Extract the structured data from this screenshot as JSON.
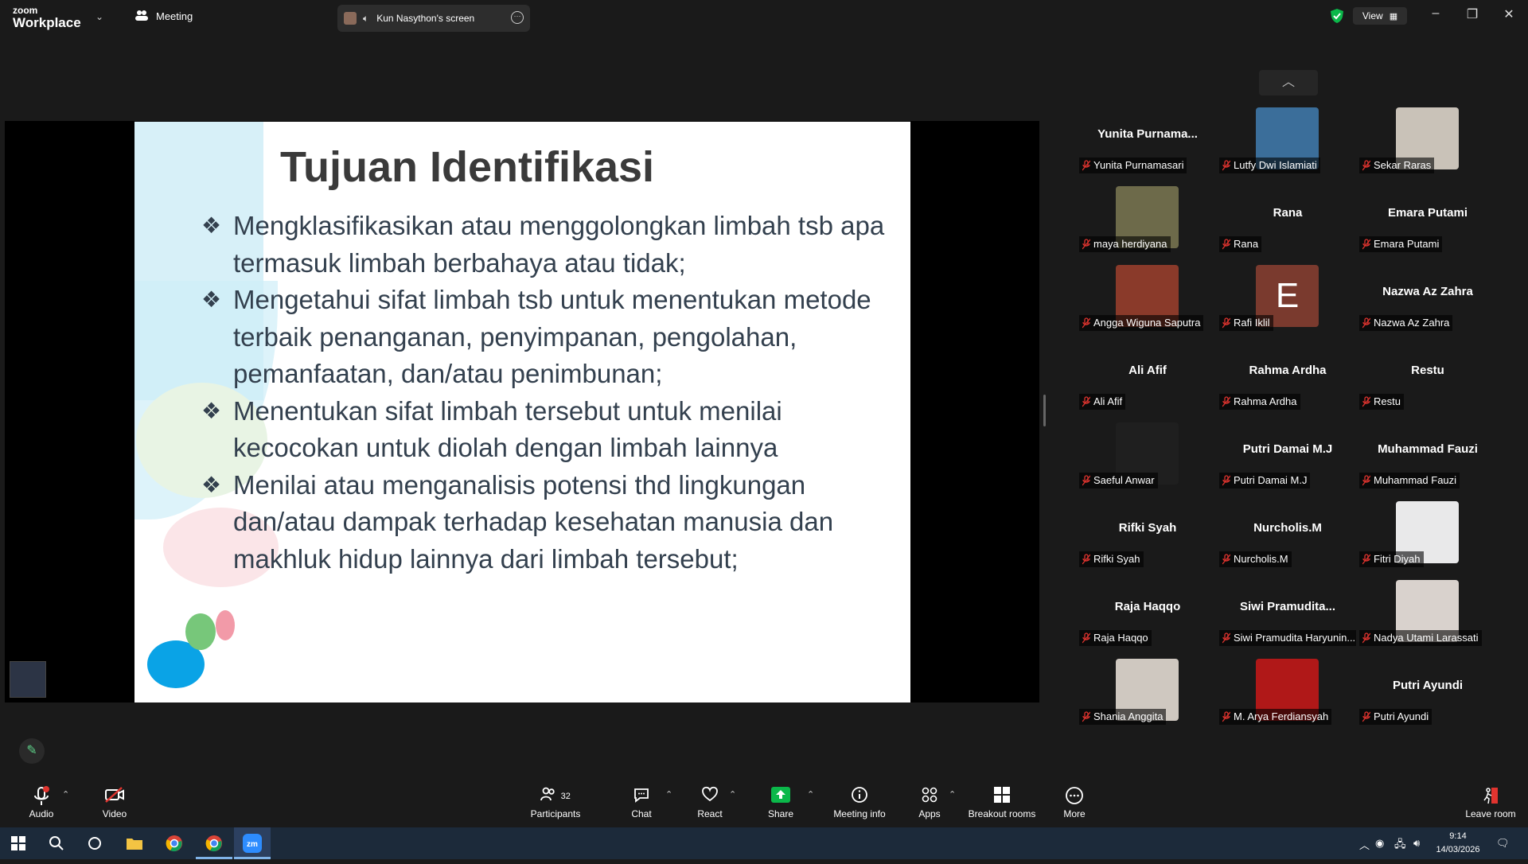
{
  "titlebar": {
    "logo_small": "zoom",
    "logo_big": "Workplace",
    "meeting_label": "Meeting",
    "screen_tab_label": "Kun Nasython's screen",
    "view_label": "View"
  },
  "slide": {
    "title": "Tujuan Identifikasi",
    "bullets": [
      "Mengklasifikasikan atau menggolongkan limbah tsb apa termasuk limbah berbahaya atau tidak;",
      "Mengetahui sifat limbah tsb untuk menentukan metode terbaik penanganan, penyimpanan, pengolahan, pemanfaatan, dan/atau penimbunan;",
      "Menentukan sifat limbah tersebut untuk menilai kecocokan untuk diolah dengan limbah lainnya",
      "Menilai atau menganalisis potensi thd lingkungan dan/atau dampak terhadap kesehatan manusia dan makhluk hidup lainnya dari limbah tersebut;"
    ],
    "bullet_mark": "❖"
  },
  "participants": [
    {
      "display": "Yunita  Purnama...",
      "label": "Yunita Purnamasari",
      "photo": false
    },
    {
      "display": "",
      "label": "Lutfy Dwi Islamiati",
      "photo": true,
      "color": "#3b6e9a"
    },
    {
      "display": "",
      "label": "Sekar Raras",
      "photo": true,
      "color": "#c9c2b8"
    },
    {
      "display": "",
      "label": "maya herdiyana",
      "photo": true,
      "color": "#6d6a4a"
    },
    {
      "display": "Rana",
      "label": "Rana",
      "photo": false
    },
    {
      "display": "Emara Putami",
      "label": "Emara Putami",
      "photo": false
    },
    {
      "display": "",
      "label": "Angga Wiguna Saputra",
      "photo": true,
      "color": "#8a3a2a"
    },
    {
      "display": "E",
      "label": "Rafi Iklil",
      "photo": "letter"
    },
    {
      "display": "Nazwa Az Zahra",
      "label": "Nazwa Az Zahra",
      "photo": false
    },
    {
      "display": "Ali Afif",
      "label": "Ali Afif",
      "photo": false
    },
    {
      "display": "Rahma Ardha",
      "label": "Rahma Ardha",
      "photo": false
    },
    {
      "display": "Restu",
      "label": "Restu",
      "photo": false
    },
    {
      "display": "",
      "label": "Saeful Anwar",
      "photo": true,
      "color": "#1f1f1f"
    },
    {
      "display": "Putri Damai M.J",
      "label": "Putri Damai M.J",
      "photo": false
    },
    {
      "display": "Muhammad Fauzi",
      "label": "Muhammad Fauzi",
      "photo": false
    },
    {
      "display": "Rifki Syah",
      "label": "Rifki Syah",
      "photo": false
    },
    {
      "display": "Nurcholis.M",
      "label": "Nurcholis.M",
      "photo": false
    },
    {
      "display": "",
      "label": "Fitri Diyah",
      "photo": true,
      "color": "#e9e9ea"
    },
    {
      "display": "Raja Haqqo",
      "label": "Raja Haqqo",
      "photo": false
    },
    {
      "display": "Siwi  Pramudita...",
      "label": "Siwi Pramudita Haryunin...",
      "photo": false
    },
    {
      "display": "",
      "label": "Nadya Utami Larassati",
      "photo": true,
      "color": "#d9d2cd"
    },
    {
      "display": "",
      "label": "Shania Anggita",
      "photo": true,
      "color": "#cfc8c0"
    },
    {
      "display": "",
      "label": "M. Arya Ferdiansyah",
      "photo": true,
      "color": "#b01818"
    },
    {
      "display": "Putri Ayundi",
      "label": "Putri Ayundi",
      "photo": false
    }
  ],
  "toolbar": {
    "audio": "Audio",
    "video": "Video",
    "participants": "Participants",
    "participants_count": "32",
    "chat": "Chat",
    "react": "React",
    "share": "Share",
    "meeting_info": "Meeting info",
    "apps": "Apps",
    "breakout": "Breakout rooms",
    "more": "More",
    "leave": "Leave room"
  },
  "taskbar": {
    "time": "9:14",
    "date": "14/03/2026"
  },
  "colors": {
    "share_green": "#0bb84a",
    "muted_red": "#e0342f",
    "slide_text": "#33404e"
  }
}
